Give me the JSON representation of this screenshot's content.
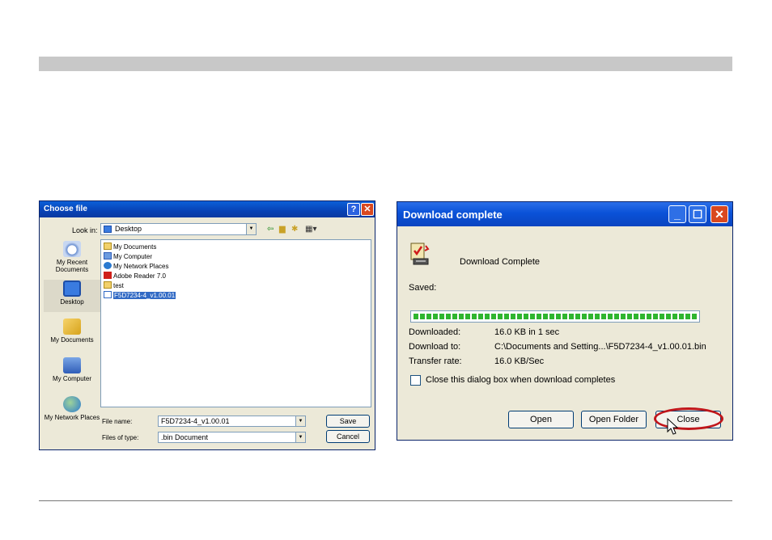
{
  "choose_file": {
    "title": "Choose file",
    "help_glyph": "?",
    "close_glyph": "✕",
    "look_in_label": "Look in:",
    "look_in_value": "Desktop",
    "places": [
      {
        "label": "My Recent Documents",
        "icon": "recent-documents-icon"
      },
      {
        "label": "Desktop",
        "icon": "desktop-icon"
      },
      {
        "label": "My Documents",
        "icon": "my-documents-icon"
      },
      {
        "label": "My Computer",
        "icon": "my-computer-icon"
      },
      {
        "label": "My Network Places",
        "icon": "network-places-icon"
      }
    ],
    "files": [
      {
        "name": "My Documents",
        "icon": "folder-icon",
        "selected": false
      },
      {
        "name": "My Computer",
        "icon": "computer-icon",
        "selected": false
      },
      {
        "name": "My Network Places",
        "icon": "network-icon",
        "selected": false
      },
      {
        "name": "Adobe Reader 7.0",
        "icon": "pdf-icon",
        "selected": false
      },
      {
        "name": "test",
        "icon": "folder-icon",
        "selected": false
      },
      {
        "name": "F5D7234-4_v1.00.01",
        "icon": "file-icon",
        "selected": true
      }
    ],
    "file_name_label": "File name:",
    "file_name_value": "F5D7234-4_v1.00.01",
    "file_type_label": "Files of type:",
    "file_type_value": ".bin Document",
    "save_label": "Save",
    "cancel_label": "Cancel"
  },
  "download": {
    "title": "Download complete",
    "heading": "Download Complete",
    "saved_label": "Saved:",
    "progress_fraction": 1.0,
    "downloaded_label": "Downloaded:",
    "downloaded_value": "16.0 KB in 1 sec",
    "download_to_label": "Download to:",
    "download_to_value": "C:\\Documents and Setting...\\F5D7234-4_v1.00.01.bin",
    "transfer_rate_label": "Transfer rate:",
    "transfer_rate_value": "16.0 KB/Sec",
    "close_checkbox_label": "Close this dialog box when download completes",
    "close_checkbox_checked": false,
    "open_label": "Open",
    "open_folder_label": "Open Folder",
    "close_label": "Close",
    "accent_color": "#c0161b"
  }
}
